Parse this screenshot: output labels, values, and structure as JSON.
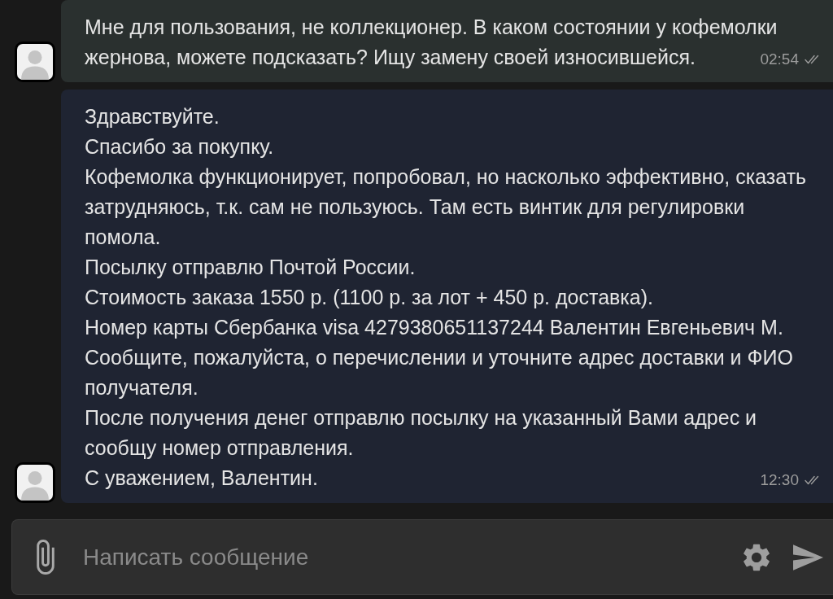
{
  "messages": [
    {
      "kind": "outgoing",
      "paragraphs": [
        "Мне для пользования, не коллекционер. В каком состоянии у кофемолки жернова, можете подсказать? Ищу замену своей износившейся."
      ],
      "time": "02:54",
      "read": true
    },
    {
      "kind": "incoming",
      "paragraphs": [
        "Здравствуйте.",
        "Спасибо за покупку.",
        "Кофемолка функционирует, попробовал, но насколько эффективно, сказать затрудняюсь, т.к. сам не пользуюсь. Там есть винтик для регулировки помола.",
        "Посылку отправлю Почтой России.",
        "Стоимость заказа 1550 р. (1100 р. за лот + 450 р. доставка).",
        "Номер карты Сбербанка visa 4279380651137244 Валентин Евгеньевич М.",
        "Сообщите, пожалуйста, о перечислении и уточните адрес доставки и ФИО получателя.",
        "После получения денег отправлю посылку на указанный Вами адрес и сообщу номер отправления.",
        "С уважением, Валентин."
      ],
      "time": "12:30",
      "read": true
    }
  ],
  "composer": {
    "placeholder": "Написать сообщение"
  }
}
